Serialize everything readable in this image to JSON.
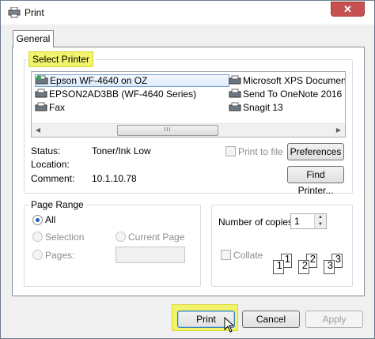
{
  "window": {
    "title": "Print",
    "close_glyph": "✕"
  },
  "tabs": [
    {
      "label": "General"
    }
  ],
  "select_printer": {
    "label": "Select Printer",
    "printers": [
      {
        "name": "Epson WF-4640 on OZ",
        "icon": "printer-default-icon",
        "selected": true
      },
      {
        "name": "EPSON2AD3BB (WF-4640 Series)",
        "icon": "printer-icon"
      },
      {
        "name": "Fax",
        "icon": "fax-icon"
      },
      {
        "name": "Microsoft XPS Document",
        "icon": "printer-icon"
      },
      {
        "name": "Send To OneNote 2016",
        "icon": "printer-icon"
      },
      {
        "name": "Snagit 13",
        "icon": "printer-icon"
      }
    ],
    "scroll_left": "◀",
    "scroll_right": "▶",
    "scroll_thumb": "III"
  },
  "status": {
    "status_label": "Status:",
    "status_value": "Toner/Ink Low",
    "location_label": "Location:",
    "location_value": "",
    "comment_label": "Comment:",
    "comment_value": "10.1.10.78",
    "print_to_file": "Print to file",
    "preferences": "Preferences",
    "find_printer": "Find Printer..."
  },
  "page_range": {
    "label": "Page Range",
    "all": "All",
    "selection": "Selection",
    "current_page": "Current Page",
    "pages": "Pages:",
    "pages_value": ""
  },
  "copies": {
    "label": "Number of copies:",
    "value": "1",
    "collate": "Collate",
    "up": "▲",
    "down": "▼",
    "page_numbers": [
      "1",
      "1",
      "2",
      "2",
      "3",
      "3"
    ]
  },
  "buttons": {
    "print": "Print",
    "cancel": "Cancel",
    "apply": "Apply"
  },
  "colors": {
    "highlight": "#f3f36b",
    "accent": "#3c7fb1"
  }
}
